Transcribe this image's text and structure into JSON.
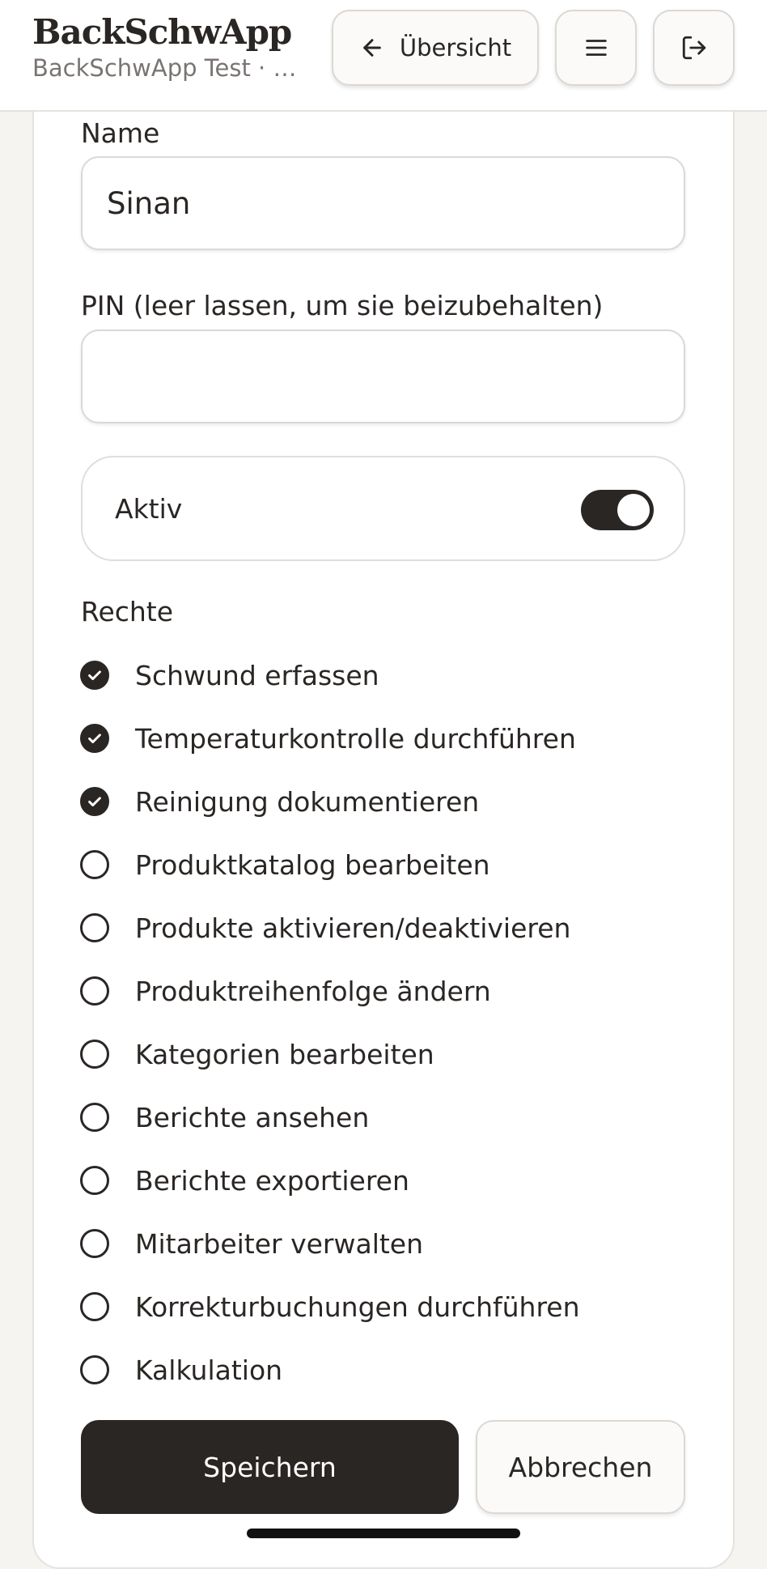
{
  "header": {
    "title": "BackSchwApp",
    "subtitle": "BackSchwApp Test · Ha...",
    "overview_label": "Übersicht",
    "back_icon": "arrow-left-icon",
    "menu_icon": "menu-icon",
    "logout_icon": "logout-icon"
  },
  "form": {
    "name_label": "Name",
    "name_value": "Sinan",
    "pin_label": "PIN (leer lassen, um sie beizubehalten)",
    "pin_value": "",
    "active_label": "Aktiv",
    "active_on": true,
    "rights_label": "Rechte",
    "rights": [
      {
        "label": "Schwund erfassen",
        "checked": true
      },
      {
        "label": "Temperaturkontrolle durchführen",
        "checked": true
      },
      {
        "label": "Reinigung dokumentieren",
        "checked": true
      },
      {
        "label": "Produktkatalog bearbeiten",
        "checked": false
      },
      {
        "label": "Produkte aktivieren/deaktivieren",
        "checked": false
      },
      {
        "label": "Produktreihenfolge ändern",
        "checked": false
      },
      {
        "label": "Kategorien bearbeiten",
        "checked": false
      },
      {
        "label": "Berichte ansehen",
        "checked": false
      },
      {
        "label": "Berichte exportieren",
        "checked": false
      },
      {
        "label": "Mitarbeiter verwalten",
        "checked": false
      },
      {
        "label": "Korrekturbuchungen durchführen",
        "checked": false
      },
      {
        "label": "Kalkulation",
        "checked": false
      }
    ],
    "save_label": "Speichern",
    "cancel_label": "Abbrechen"
  },
  "colors": {
    "primary": "#2a2624",
    "background": "#f6f4f1"
  }
}
